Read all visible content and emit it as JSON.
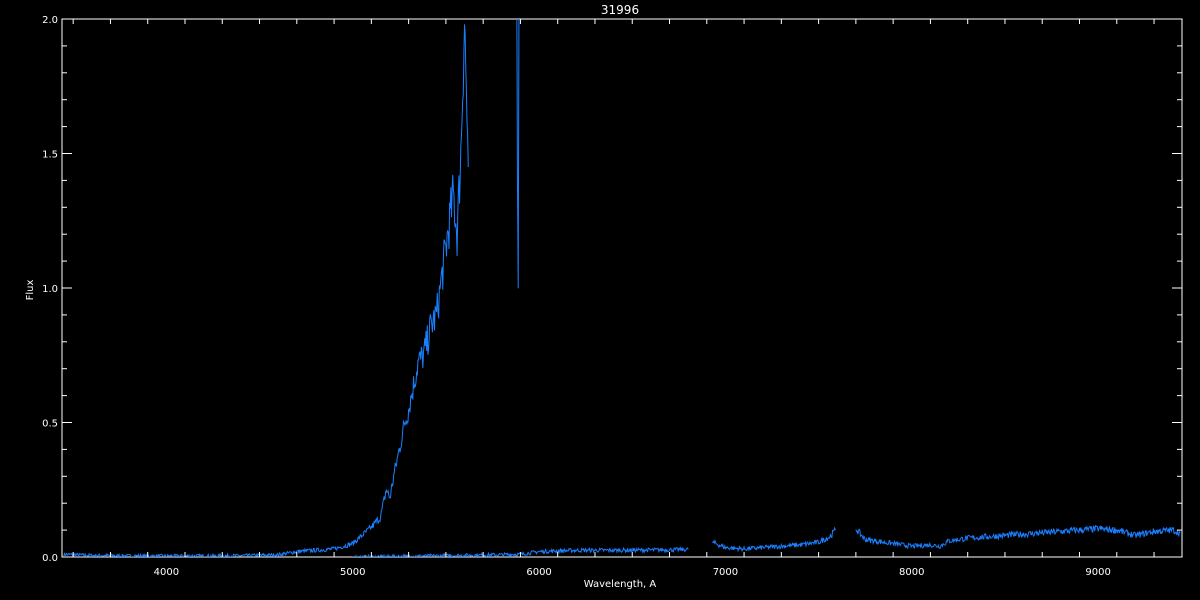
{
  "chart_data": {
    "type": "line",
    "title": "31996",
    "xlabel": "Wavelength, A",
    "ylabel": "Flux",
    "xlim": [
      3440,
      9450
    ],
    "ylim": [
      0.0,
      2.0
    ],
    "x_ticks": [
      4000,
      5000,
      6000,
      7000,
      8000,
      9000
    ],
    "x_tick_labels": [
      "4000",
      "5000",
      "6000",
      "7000",
      "8000",
      "9000"
    ],
    "y_ticks": [
      0.0,
      0.5,
      1.0,
      1.5,
      2.0
    ],
    "y_tick_labels": [
      "0.0",
      "0.5",
      "1.0",
      "1.5",
      "2.0"
    ],
    "grid": false,
    "line_color": "#1a7fff",
    "axis_color": "#ffffff",
    "background": "#000000",
    "series": [
      {
        "segments": [
          {
            "x": [
              3450,
              3600,
              3800,
              4000,
              4200,
              4400,
              4600,
              4700,
              4800,
              4900,
              4950,
              5000,
              5050,
              5100,
              5150,
              5180,
              5200,
              5220,
              5250,
              5280,
              5300,
              5330,
              5350,
              5380,
              5400,
              5420,
              5450,
              5480,
              5500,
              5520,
              5540,
              5560,
              5580,
              5600,
              5620
            ],
            "y": [
              0.01,
              0.006,
              0.004,
              0.004,
              0.004,
              0.005,
              0.008,
              0.02,
              0.025,
              0.03,
              0.04,
              0.05,
              0.08,
              0.11,
              0.15,
              0.25,
              0.22,
              0.3,
              0.4,
              0.5,
              0.55,
              0.65,
              0.72,
              0.75,
              0.8,
              0.86,
              0.9,
              1.05,
              1.15,
              1.25,
              1.35,
              1.2,
              1.5,
              2.0,
              1.45
            ]
          },
          {
            "x": [
              5880,
              5884,
              5888,
              5892
            ],
            "y": [
              2.0,
              1.4,
              0.93,
              2.0
            ]
          },
          {
            "x": [
              5000,
              5500,
              5900,
              6000,
              6200,
              6400,
              6600,
              6800
            ],
            "y": [
              0.0,
              0.005,
              0.01,
              0.02,
              0.025,
              0.025,
              0.026,
              0.028
            ]
          },
          {
            "x": [
              6930,
              7000,
              7100,
              7200,
              7300,
              7400,
              7500,
              7560,
              7590
            ],
            "y": [
              0.055,
              0.035,
              0.03,
              0.035,
              0.04,
              0.045,
              0.055,
              0.075,
              0.1
            ]
          },
          {
            "x": [
              7700,
              7750,
              7800,
              7900,
              8000,
              8100,
              8150,
              8200,
              8300,
              8400,
              8500,
              8600,
              8700,
              8800,
              8900,
              9000,
              9100,
              9200,
              9300,
              9400,
              9440
            ],
            "y": [
              0.105,
              0.065,
              0.06,
              0.05,
              0.04,
              0.045,
              0.04,
              0.06,
              0.07,
              0.075,
              0.08,
              0.085,
              0.09,
              0.095,
              0.1,
              0.105,
              0.1,
              0.08,
              0.095,
              0.1,
              0.09
            ]
          }
        ]
      }
    ]
  }
}
